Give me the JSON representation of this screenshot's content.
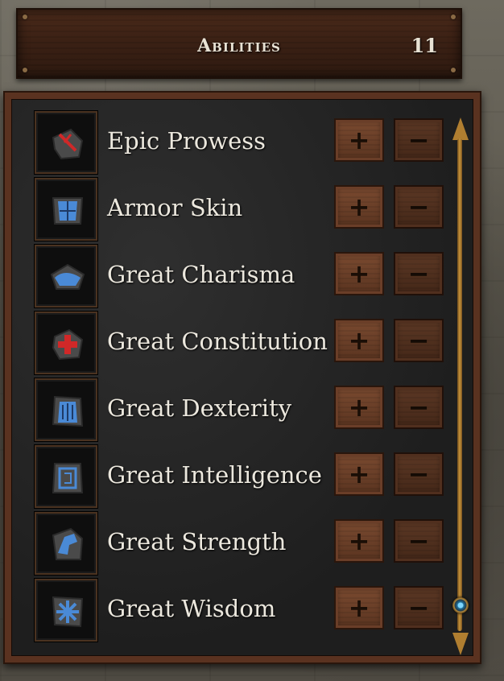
{
  "header": {
    "title": "Abilities",
    "count": "11"
  },
  "buttons": {
    "plus_glyph": "+",
    "minus_glyph": "−"
  },
  "abilities": [
    {
      "name": "Epic Prowess",
      "icon": "crossed-blades-icon",
      "color": "#d02828"
    },
    {
      "name": "Armor Skin",
      "icon": "armor-shield-icon",
      "color": "#4a8ad6"
    },
    {
      "name": "Great Charisma",
      "icon": "handshake-icon",
      "color": "#4a8ad6"
    },
    {
      "name": "Great Constitution",
      "icon": "red-cross-icon",
      "color": "#d02828"
    },
    {
      "name": "Great Dexterity",
      "icon": "dexterity-hand-icon",
      "color": "#4a8ad6"
    },
    {
      "name": "Great Intelligence",
      "icon": "tome-icon",
      "color": "#4a8ad6"
    },
    {
      "name": "Great Strength",
      "icon": "flexed-arm-icon",
      "color": "#4a8ad6"
    },
    {
      "name": "Great Wisdom",
      "icon": "rune-star-icon",
      "color": "#4a8ad6"
    }
  ],
  "scroll": {
    "position_fraction": 1.0
  }
}
